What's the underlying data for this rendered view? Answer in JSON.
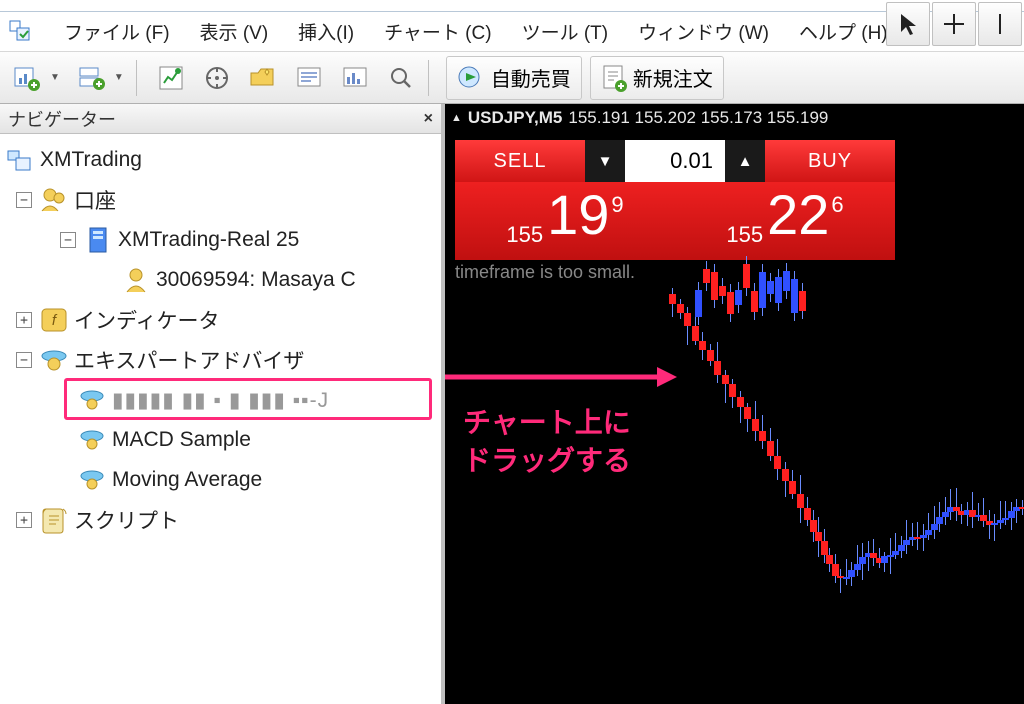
{
  "menu": {
    "file": "ファイル (F)",
    "view": "表示 (V)",
    "insert": "挿入(I)",
    "chart": "チャート (C)",
    "tools": "ツール (T)",
    "window": "ウィンドウ (W)",
    "help": "ヘルプ (H)"
  },
  "toolbar": {
    "autotrade": "自動売買",
    "neworder": "新規注文"
  },
  "navigator": {
    "title": "ナビゲーター",
    "root": "XMTrading",
    "accounts": "口座",
    "server": "XMTrading-Real 25",
    "login": "30069594: Masaya C",
    "indicators": "インディケータ",
    "experts": "エキスパートアドバイザ",
    "ea_blurred": "▮▮▮▮▮ ▮▮  ▪ ▮ ▮▮▮ ▪▪-J",
    "ea_macd": "MACD Sample",
    "ea_ma": "Moving Average",
    "scripts": "スクリプト"
  },
  "chart": {
    "symbol": "USDJPY,M5",
    "ohlc": "155.191 155.202 155.173 155.199",
    "sell_label": "SELL",
    "buy_label": "BUY",
    "volume": "0.01",
    "sell_handle": "155",
    "sell_big": "19",
    "sell_frac": "9",
    "buy_handle": "155",
    "buy_big": "22",
    "buy_frac": "6",
    "truncated": "timeframe is too small."
  },
  "annotation": {
    "text": "チャート上に\nドラッグする"
  }
}
